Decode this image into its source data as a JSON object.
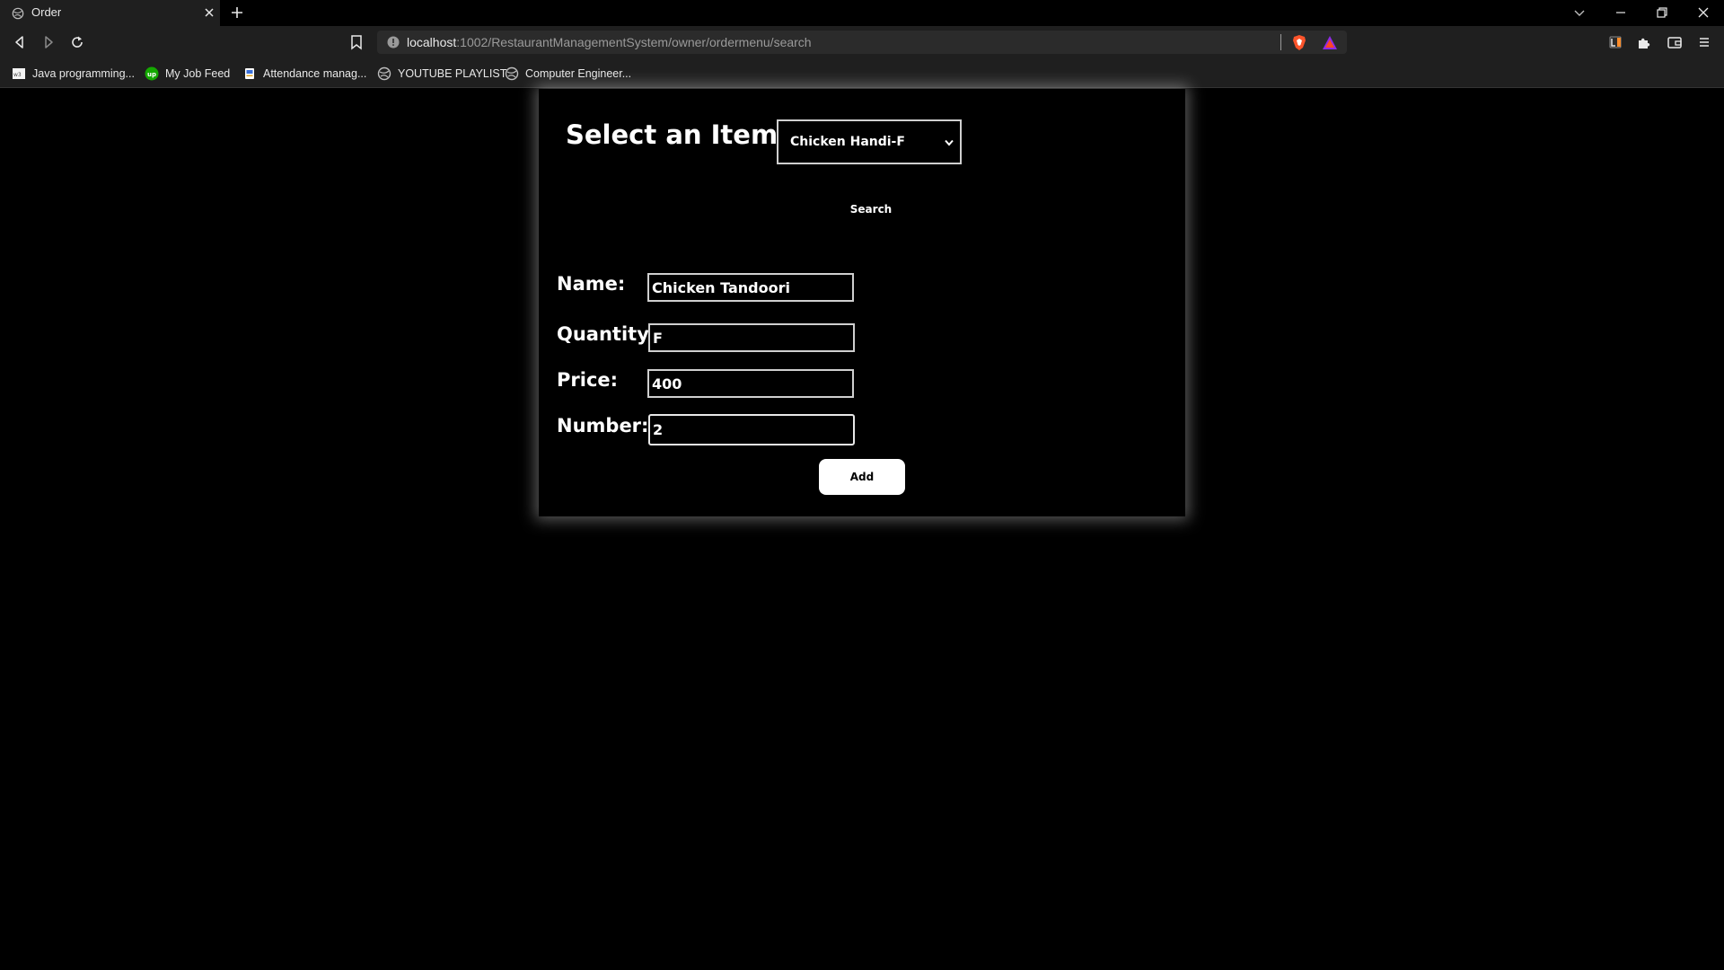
{
  "browser": {
    "tab_title": "Order",
    "url_host": "localhost",
    "url_rest": ":1002/RestaurantManagementSystem/owner/ordermenu/search",
    "bookmarks": [
      {
        "label": "Java programming...",
        "icon": "web-icon"
      },
      {
        "label": "My Job Feed",
        "icon": "upwork-icon"
      },
      {
        "label": "Attendance manag...",
        "icon": "attendance-icon"
      },
      {
        "label": "YOUTUBE PLAYLIST",
        "icon": "globe-icon"
      },
      {
        "label": "Computer Engineer...",
        "icon": "globe-icon"
      }
    ],
    "colors": {
      "chrome_bg": "#1f1f1f",
      "brave_orange": "#fb542b",
      "upwork_green": "#14a800"
    }
  },
  "page": {
    "select_label": "Select an Item:",
    "select_value": "Chicken Handi-F",
    "search_label": "Search",
    "form": {
      "name_label": "Name:",
      "name_value": "Chicken Tandoori",
      "quantity_label": "Quantity:",
      "quantity_value": "F",
      "price_label": "Price:",
      "price_value": "400",
      "number_label": "Number:",
      "number_value": "2"
    },
    "add_label": "Add"
  }
}
